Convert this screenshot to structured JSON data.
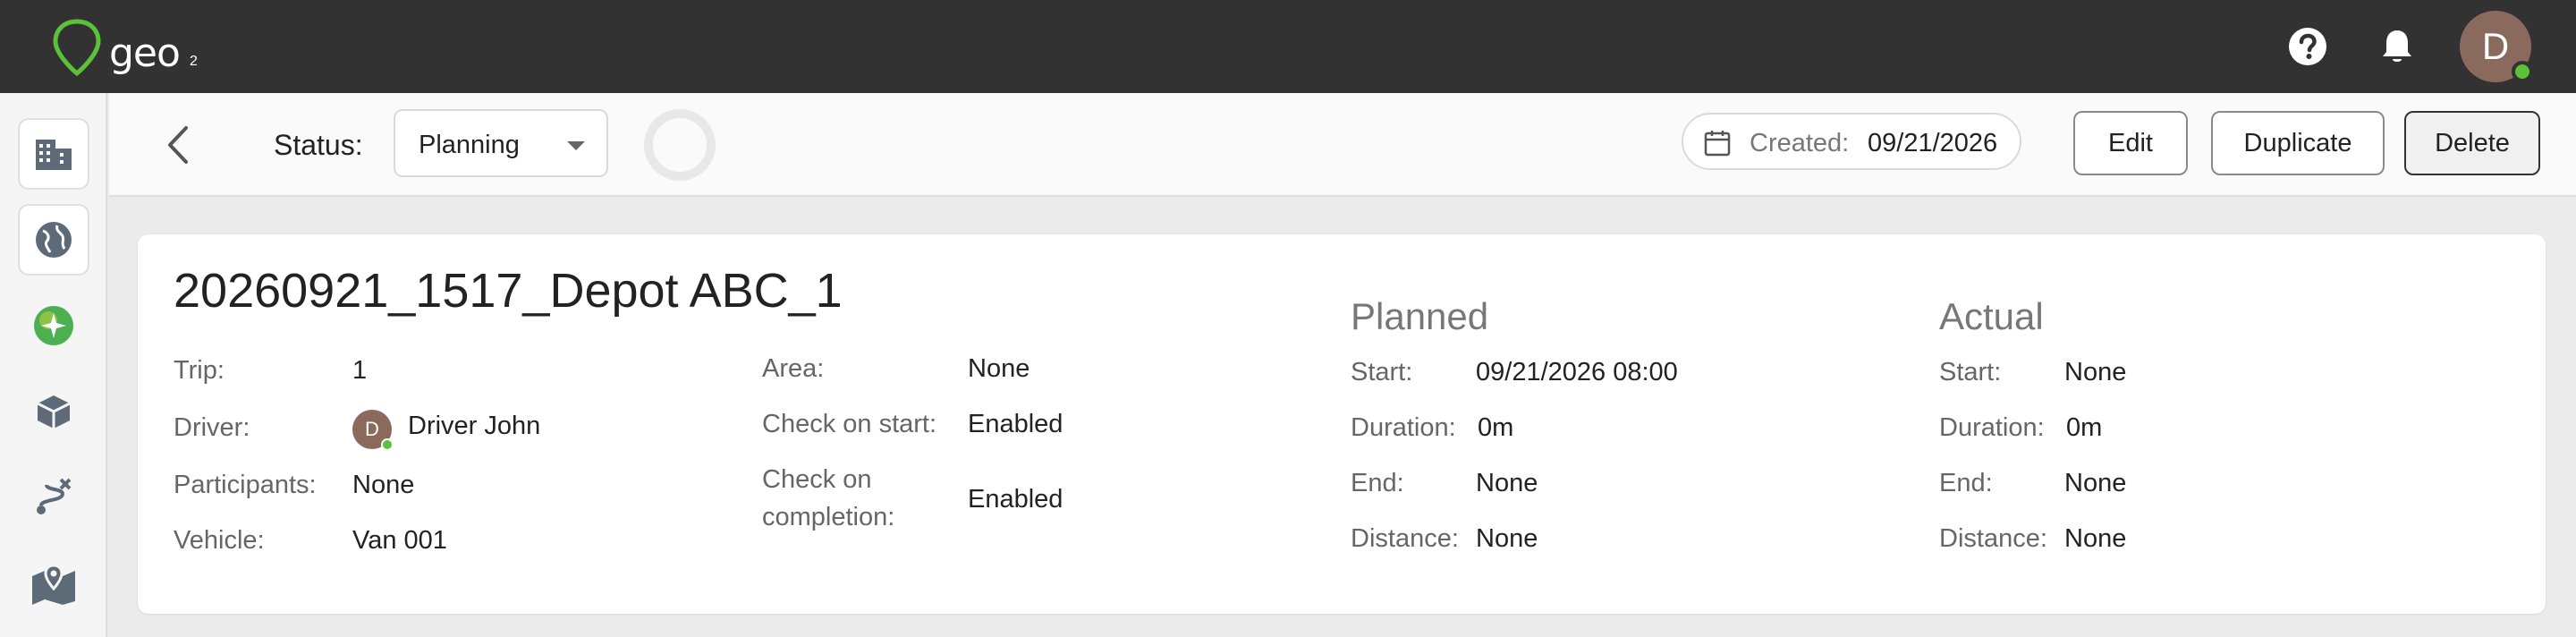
{
  "app": {
    "logo_text": "geo",
    "logo_sub": "2"
  },
  "header": {
    "user_initial": "D"
  },
  "icons": {
    "help": "help-circle-icon",
    "notifications": "bell-icon",
    "sidebar": [
      "building-icon",
      "globe-icon",
      "sparkle-globe-icon",
      "package-icon",
      "route-icon",
      "map-pin-icon"
    ]
  },
  "toolbar": {
    "status_label": "Status:",
    "status_value": "Planning",
    "created_label": "Created:",
    "created_date": "09/21/2026",
    "edit_label": "Edit",
    "duplicate_label": "Duplicate",
    "delete_label": "Delete"
  },
  "trip": {
    "title": "20260921_1517_Depot ABC_1",
    "details": {
      "trip_label": "Trip:",
      "trip_value": "1",
      "driver_label": "Driver:",
      "driver_initial": "D",
      "driver_value": "Driver John",
      "participants_label": "Participants:",
      "participants_value": "None",
      "vehicle_label": "Vehicle:",
      "vehicle_value": "Van 001",
      "area_label": "Area:",
      "area_value": "None",
      "check_start_label": "Check on start:",
      "check_start_value": "Enabled",
      "check_completion_label_1": "Check on",
      "check_completion_label_2": "completion:",
      "check_completion_value": "Enabled"
    },
    "planned": {
      "heading": "Planned",
      "start_label": "Start:",
      "start_value": "09/21/2026 08:00",
      "duration_label": "Duration:",
      "duration_value": "0m",
      "end_label": "End:",
      "end_value": "None",
      "distance_label": "Distance:",
      "distance_value": "None"
    },
    "actual": {
      "heading": "Actual",
      "start_label": "Start:",
      "start_value": "None",
      "duration_label": "Duration:",
      "duration_value": "0m",
      "end_label": "End:",
      "end_value": "None",
      "distance_label": "Distance:",
      "distance_value": "None"
    }
  },
  "colors": {
    "topbar": "#323232",
    "brand_green": "#5cc13a",
    "avatar": "#8b6a5e"
  }
}
